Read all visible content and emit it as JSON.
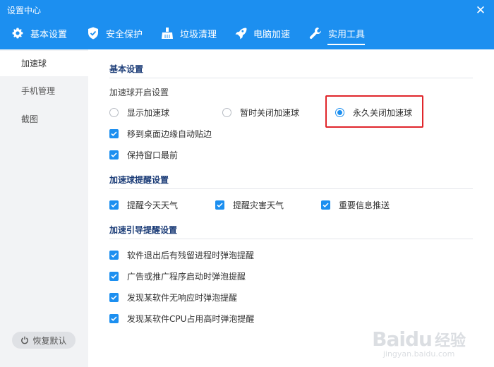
{
  "window": {
    "title": "设置中心",
    "close_glyph": "✕"
  },
  "tabs": [
    {
      "label": "基本设置",
      "icon": "gear-icon"
    },
    {
      "label": "安全保护",
      "icon": "shield-icon"
    },
    {
      "label": "垃圾清理",
      "icon": "broom-icon"
    },
    {
      "label": "电脑加速",
      "icon": "rocket-icon"
    },
    {
      "label": "实用工具",
      "icon": "wrench-icon",
      "active": true
    }
  ],
  "sidebar": {
    "items": [
      {
        "label": "加速球",
        "active": true
      },
      {
        "label": "手机管理"
      },
      {
        "label": "截图"
      }
    ],
    "restore_label": "恢复默认"
  },
  "sections": {
    "basic": {
      "title": "基本设置",
      "sub_label": "加速球开启设置",
      "radios": [
        {
          "label": "显示加速球",
          "selected": false
        },
        {
          "label": "暂时关闭加速球",
          "selected": false
        },
        {
          "label": "永久关闭加速球",
          "selected": true
        }
      ],
      "checks": [
        {
          "label": "移到桌面边缘自动贴边",
          "checked": true
        },
        {
          "label": "保持窗口最前",
          "checked": true
        }
      ]
    },
    "reminder": {
      "title": "加速球提醒设置",
      "checks": [
        {
          "label": "提醒今天天气",
          "checked": true
        },
        {
          "label": "提醒灾害天气",
          "checked": true
        },
        {
          "label": "重要信息推送",
          "checked": true
        }
      ]
    },
    "guide": {
      "title": "加速引导提醒设置",
      "checks": [
        {
          "label": "软件退出后有残留进程时弹泡提醒",
          "checked": true
        },
        {
          "label": "广告或推广程序启动时弹泡提醒",
          "checked": true
        },
        {
          "label": "发现某软件无响应时弹泡提醒",
          "checked": true
        },
        {
          "label": "发现某软件CPU占用高时弹泡提醒",
          "checked": true
        }
      ]
    }
  },
  "watermark": {
    "brand": "Baidu",
    "brand_cn": "经验",
    "url": "jingyan.baidu.com"
  },
  "colors": {
    "accent": "#1c8ff0",
    "sidebar_bg": "#f2f3f5",
    "highlight": "#e0262b",
    "section_title": "#1c3d78"
  }
}
